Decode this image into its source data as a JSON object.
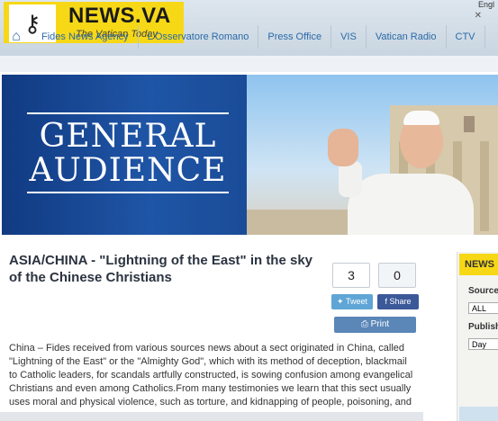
{
  "header": {
    "logo_text": "NEWS.VA",
    "tagline": "The Vatican Today",
    "lang": "Engl",
    "nav": [
      "Fides News Agency",
      "L'Osservatore Romano",
      "Press Office",
      "VIS",
      "Vatican Radio",
      "CTV"
    ]
  },
  "banner": {
    "line1": "GENERAL",
    "line2": "AUDIENCE"
  },
  "article": {
    "title": "ASIA/CHINA - \"Lightning of the East\" in the sky of the Chinese Christians",
    "count_tweets": "3",
    "count_shares": "0",
    "tweet_label": "Tweet",
    "share_label": "Share",
    "print_label": "Print",
    "body": "China – Fides received from various sources news about a sect originated in China, called \"Lightning of the East\" or the \"Almighty God\", which with its method of deception, blackmail to Catholic leaders, for scandals artfully constructed, is sowing confusion among evangelical Christians and even among Catholics.From many testimonies we learn that this sect usually uses moral and physical violence, such as torture, and kidnapping of people, poisoning, and"
  },
  "sidebar": {
    "title": "NEWS",
    "source_label": "Source",
    "source_value": "ALL",
    "publish_label": "Publish",
    "publish_value": "Day"
  },
  "colors": {
    "brand_yellow": "#f7d817",
    "banner_blue": "#1f55a6",
    "link_blue": "#2b6aa8"
  }
}
